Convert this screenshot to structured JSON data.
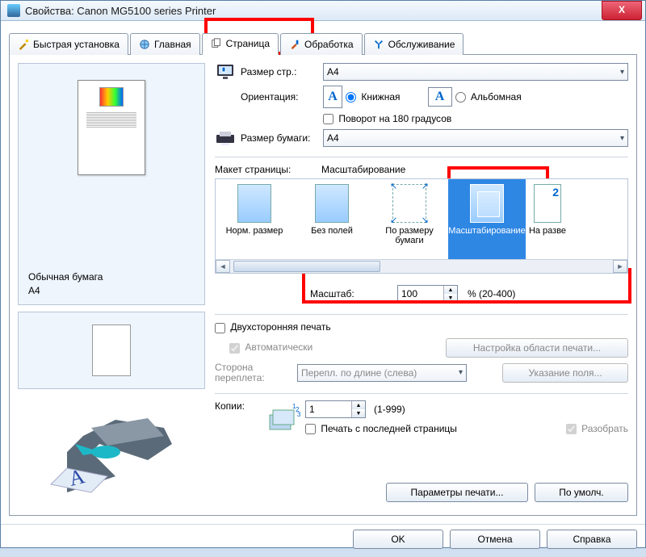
{
  "window": {
    "title": "Свойства: Canon MG5100 series Printer"
  },
  "tabs": {
    "quick": "Быстрая установка",
    "main": "Главная",
    "page": "Страница",
    "proc": "Обработка",
    "maint": "Обслуживание"
  },
  "preview": {
    "media": "Обычная бумага",
    "size": "A4"
  },
  "page_size": {
    "label": "Размер стр.:",
    "value": "A4"
  },
  "orientation": {
    "label": "Ориентация:",
    "portrait": "Книжная",
    "landscape": "Альбомная",
    "rotate180": "Поворот на 180 градусов"
  },
  "paper": {
    "label": "Размер бумаги:",
    "value": "A4"
  },
  "layout": {
    "label": "Макет страницы:",
    "value": "Масштабирование",
    "items": {
      "normal": "Норм. размер",
      "borderless": "Без полей",
      "fit": "По размеру бумаги",
      "scaled": "Масштабирование",
      "nup": "На разве"
    }
  },
  "scale": {
    "label": "Масштаб:",
    "value": "100",
    "range": "% (20-400)"
  },
  "duplex": {
    "label": "Двухсторонняя печать",
    "auto": "Автоматически",
    "area_btn": "Настройка области печати...",
    "side_label": "Сторона переплета:",
    "side_value": "Перепл. по длине (слева)",
    "margin_btn": "Указание поля..."
  },
  "copies": {
    "label": "Копии:",
    "value": "1",
    "range": "(1-999)",
    "from_last": "Печать с последней страницы",
    "collate": "Разобрать"
  },
  "bottom": {
    "params": "Параметры печати...",
    "defaults": "По умолч."
  },
  "footer": {
    "ok": "OK",
    "cancel": "Отмена",
    "help": "Справка"
  }
}
